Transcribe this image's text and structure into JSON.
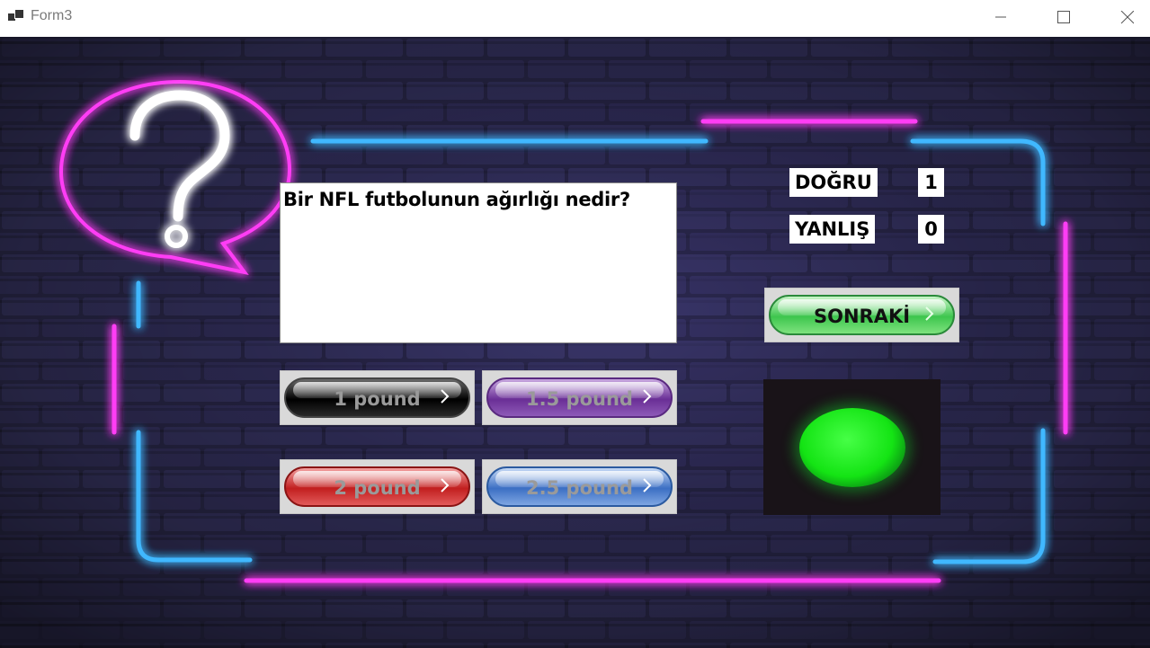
{
  "window": {
    "title": "Form3"
  },
  "question": {
    "text": "Bir NFL futbolunun ağırlığı nedir?"
  },
  "answers": [
    {
      "label": "1 pound",
      "color": "#000000"
    },
    {
      "label": "1.5 pound",
      "color": "#6a2f96"
    },
    {
      "label": "2 pound",
      "color": "#c21f1f"
    },
    {
      "label": "2.5 pound",
      "color": "#3c6fc4"
    }
  ],
  "score": {
    "correct_label": "DOĞRU",
    "correct_value": "1",
    "wrong_label": "YANLIŞ",
    "wrong_value": "0"
  },
  "next_button": {
    "label": "SONRAKİ",
    "color": "#3ec64e"
  },
  "indicator": {
    "state_color": "#14e414",
    "icon": "green-light-icon"
  },
  "colors": {
    "neon_pink": "#ff3df5",
    "neon_blue": "#3fb8ff"
  }
}
